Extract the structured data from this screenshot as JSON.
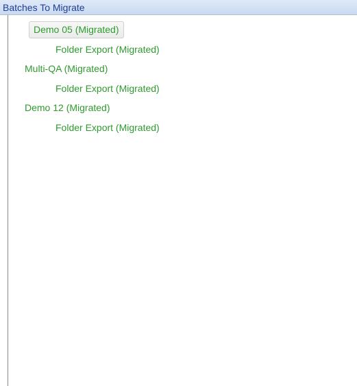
{
  "panel": {
    "header_title": "Batches To Migrate"
  },
  "tree": {
    "items": [
      {
        "label": "Demo 05 (Migrated)",
        "level": 0,
        "selected": true
      },
      {
        "label": "Folder Export (Migrated)",
        "level": 1,
        "selected": false
      },
      {
        "label": "Multi-QA (Migrated)",
        "level": 0,
        "selected": false
      },
      {
        "label": "Folder Export (Migrated)",
        "level": 1,
        "selected": false
      },
      {
        "label": "Demo 12 (Migrated)",
        "level": 0,
        "selected": false
      },
      {
        "label": "Folder Export (Migrated)",
        "level": 1,
        "selected": false
      }
    ]
  },
  "colors": {
    "item_text": "#2f9a2f",
    "header_text": "#1f3f8f",
    "header_bg": "#d3e2f5"
  }
}
